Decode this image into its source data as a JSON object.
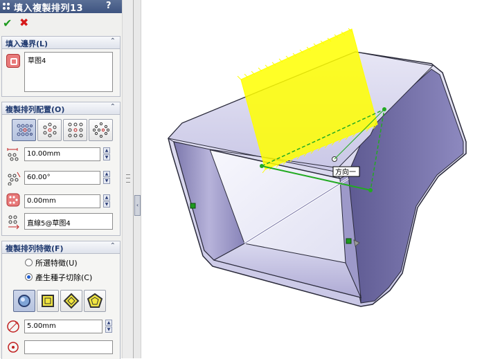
{
  "panel": {
    "title": "填入複製排列13",
    "help_label": "?",
    "ok_label": "✔",
    "cancel_label": "✖"
  },
  "fill_boundary": {
    "header": "填入邊界(L)",
    "selection": "草图4"
  },
  "pattern_layout": {
    "header": "複製排列配置(O)",
    "layout_buttons": [
      "perforation-layout-icon",
      "circular-layout-icon",
      "square-layout-icon",
      "polygon-layout-icon"
    ],
    "selected_layout_index": 0,
    "instance_spacing": "10.00mm",
    "stagger_angle": "60.00°",
    "margin": "0.00mm",
    "direction": "直線5@草图4"
  },
  "features_to_pattern": {
    "header": "複製排列特徵(F)",
    "option_selected_features": "所選特徵(U)",
    "option_seed_cut": "產生種子切除(C)",
    "selected_option": "seed_cut",
    "seed_shapes": [
      "circle-shape-icon",
      "square-shape-icon",
      "diamond-shape-icon",
      "polygon-shape-icon"
    ],
    "selected_shape_index": 0,
    "diameter": "5.00mm",
    "vertex_value": ""
  },
  "viewport": {
    "callout_label": "方向一",
    "colors": {
      "preview_yellow": "#ffff00",
      "direction_green": "#22aa22",
      "body_purple": "#8a86b8"
    }
  }
}
